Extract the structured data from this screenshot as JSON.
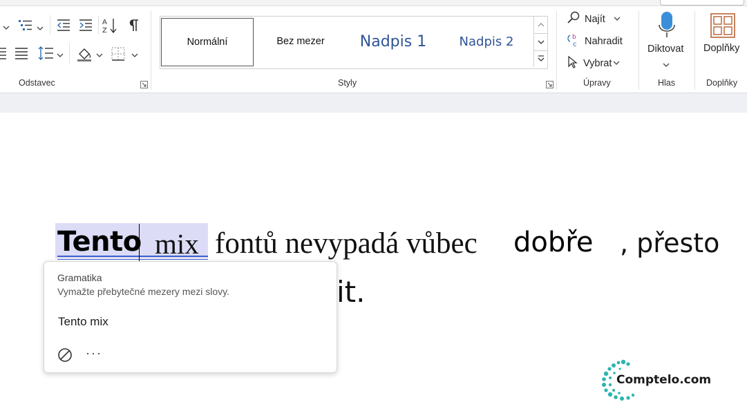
{
  "ribbon": {
    "groups": {
      "paragraph": "Odstavec",
      "styles": "Styly",
      "editing": "Úpravy",
      "voice": "Hlas",
      "addins": "Doplňky"
    },
    "styles_gallery": [
      "Normální",
      "Bez mezer",
      "Nadpis 1",
      "Nadpis 2"
    ],
    "editing": {
      "find": "Najít",
      "replace": "Nahradit",
      "select": "Vybrat"
    },
    "voice": {
      "dictate": "Diktovat"
    },
    "addins": {
      "addins_button": "Doplňky"
    },
    "icons": [
      "bullets-icon",
      "multilevel-list-icon",
      "decrease-indent-icon",
      "increase-indent-icon",
      "sort-icon",
      "pilcrow-icon",
      "justify-icon",
      "line-spacing-icon",
      "shading-icon",
      "borders-icon",
      "find-icon",
      "replace-icon",
      "select-cursor-icon",
      "microphone-icon",
      "addins-grid-icon"
    ],
    "accent_colors": {
      "heading": "#2f5496",
      "addins": "#c0734a",
      "mic": "#3b8fd9"
    }
  },
  "document": {
    "line1": {
      "word1": "Tento",
      "word2": "mix",
      "rest": "fontů nevypadá vůbec",
      "word_bold": "dobře",
      "end": ", přesto"
    },
    "line2_visible": "it."
  },
  "grammar_popup": {
    "category": "Gramatika",
    "description": "Vymažte přebytečné mezery mezi slovy.",
    "suggestion": "Tento mix",
    "more": "···",
    "highlight_color": "#dcdcf7",
    "underline_color": "#3a5fcd"
  },
  "watermark": {
    "text": "Comptelo.com",
    "color": "#2bb5b0"
  }
}
